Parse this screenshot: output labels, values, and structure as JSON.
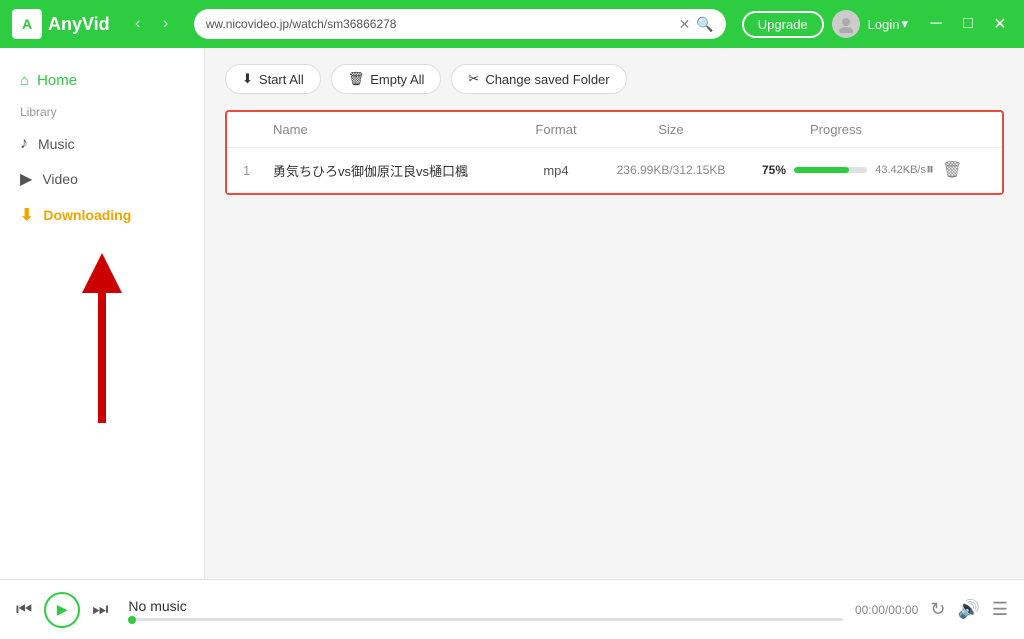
{
  "app": {
    "name": "AnyVid",
    "logo_letter": "A"
  },
  "titlebar": {
    "url": "ww.nicovideo.jp/watch/sm36866278",
    "upgrade_label": "Upgrade",
    "login_label": "Login"
  },
  "sidebar": {
    "home_label": "Home",
    "section_label": "Library",
    "items": [
      {
        "id": "music",
        "label": "Music",
        "icon": "♪"
      },
      {
        "id": "video",
        "label": "Video",
        "icon": "▶"
      },
      {
        "id": "downloading",
        "label": "Downloading",
        "icon": "⬇",
        "active": true
      }
    ]
  },
  "toolbar": {
    "start_all": "Start All",
    "empty_all": "Empty All",
    "change_folder": "Change saved Folder"
  },
  "table": {
    "headers": {
      "name": "Name",
      "format": "Format",
      "size": "Size",
      "progress": "Progress"
    },
    "rows": [
      {
        "num": "1",
        "name": "勇気ちひろvs御伽原江良vs樋口楓",
        "format": "mp4",
        "size": "236.99KB/312.15KB",
        "progress_pct": 75,
        "progress_label": "75%",
        "speed": "43.42KB/s"
      }
    ]
  },
  "player": {
    "no_music": "No music",
    "time": "00:00/00:00"
  }
}
